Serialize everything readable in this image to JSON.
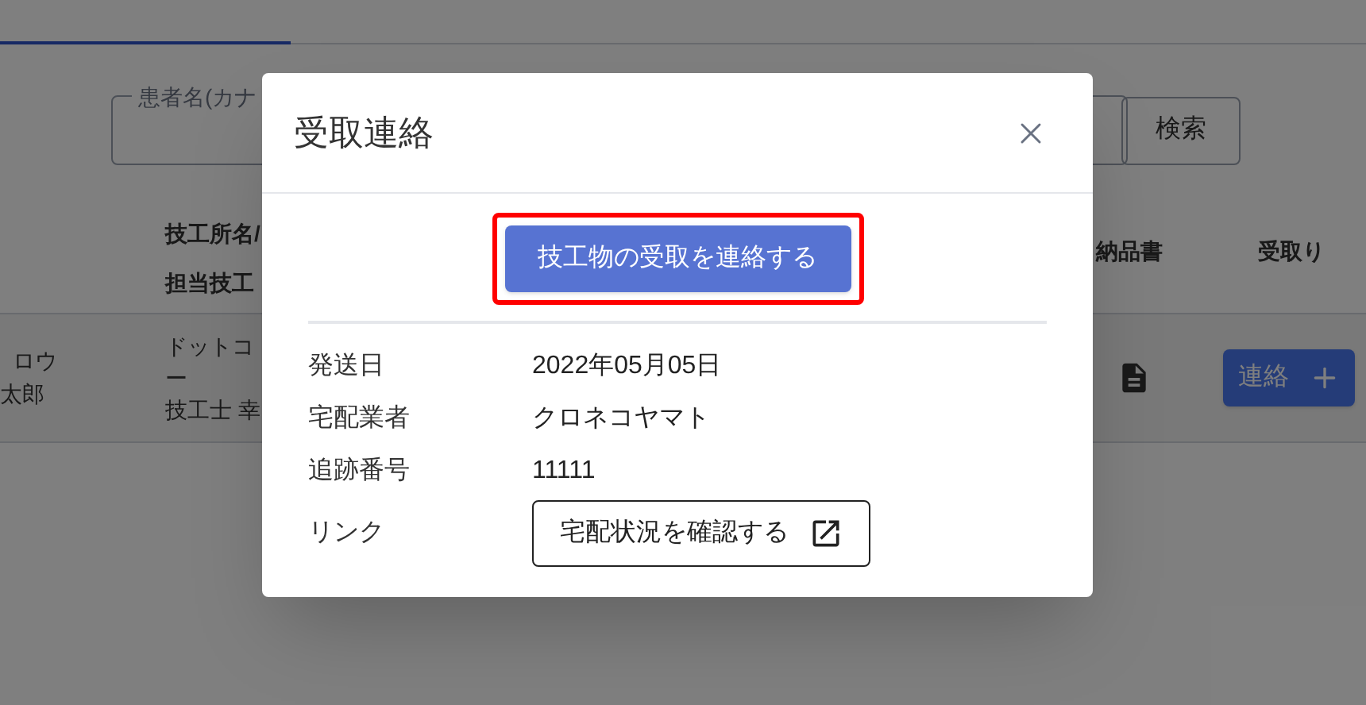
{
  "tabs": [
    {
      "selected": true
    }
  ],
  "search": {
    "label": "患者名(カナ",
    "button": "検索"
  },
  "table": {
    "columns": [
      {
        "lines": [
          "技工所名/",
          "担当技工"
        ]
      },
      {
        "lines": [
          "納品書"
        ]
      },
      {
        "lines": [
          "受取り"
        ]
      }
    ],
    "rows": [
      {
        "patient": [
          "ロウ",
          "太郎"
        ],
        "lab": [
          "ドットコ",
          "ー",
          "技工士 幸"
        ],
        "action": "連絡"
      }
    ]
  },
  "modal": {
    "title": "受取連絡",
    "primary_button": "技工物の受取を連絡する",
    "highlighted": true,
    "fields": [
      {
        "kind": "text",
        "label": "発送日",
        "value": "2022年05月05日"
      },
      {
        "kind": "text",
        "label": "宅配業者",
        "value": "クロネコヤマト"
      },
      {
        "kind": "text",
        "label": "追跡番号",
        "value": "11111"
      },
      {
        "kind": "link",
        "label": "リンク",
        "value": "宅配状況を確認する"
      }
    ]
  }
}
